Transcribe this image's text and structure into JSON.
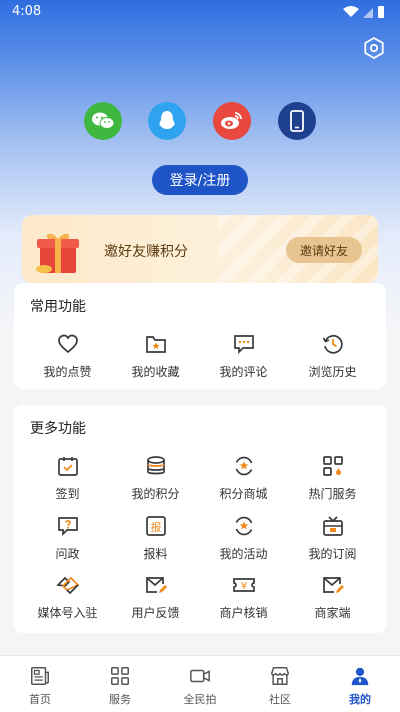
{
  "status_bar": {
    "time": "4:08"
  },
  "login": {
    "label": "登录/注册"
  },
  "invite": {
    "text": "邀好友赚积分",
    "button": "邀请好友"
  },
  "common": {
    "title": "常用功能",
    "items": [
      {
        "label": "我的点赞",
        "icon": "heart-icon"
      },
      {
        "label": "我的收藏",
        "icon": "star-folder-icon"
      },
      {
        "label": "我的评论",
        "icon": "comment-icon"
      },
      {
        "label": "浏览历史",
        "icon": "history-icon"
      }
    ]
  },
  "more": {
    "title": "更多功能",
    "items": [
      {
        "label": "签到",
        "icon": "calendar-check-icon"
      },
      {
        "label": "我的积分",
        "icon": "coins-icon"
      },
      {
        "label": "积分商城",
        "icon": "star-refresh-icon"
      },
      {
        "label": "热门服务",
        "icon": "grid-icon"
      },
      {
        "label": "问政",
        "icon": "question-icon"
      },
      {
        "label": "报料",
        "icon": "report-icon"
      },
      {
        "label": "我的活动",
        "icon": "activity-icon"
      },
      {
        "label": "我的订阅",
        "icon": "tv-icon"
      },
      {
        "label": "媒体号入驻",
        "icon": "handshake-icon"
      },
      {
        "label": "用户反馈",
        "icon": "mail-edit-icon"
      },
      {
        "label": "商户核销",
        "icon": "ticket-icon"
      },
      {
        "label": "商家端",
        "icon": "mail-icon"
      }
    ]
  },
  "tabs": [
    {
      "label": "首页",
      "icon": "news-icon"
    },
    {
      "label": "服务",
      "icon": "grid-icon"
    },
    {
      "label": "全民拍",
      "icon": "video-icon"
    },
    {
      "label": "社区",
      "icon": "store-icon"
    },
    {
      "label": "我的",
      "icon": "user-icon"
    }
  ],
  "colors": {
    "primary": "#1f54c7",
    "icon_dark": "#3a3a3a",
    "icon_accent": "#f08a1c",
    "wechat": "#3fb840",
    "qq": "#2fa2f0",
    "weibo": "#e8483e",
    "phone": "#1f3f8f"
  }
}
